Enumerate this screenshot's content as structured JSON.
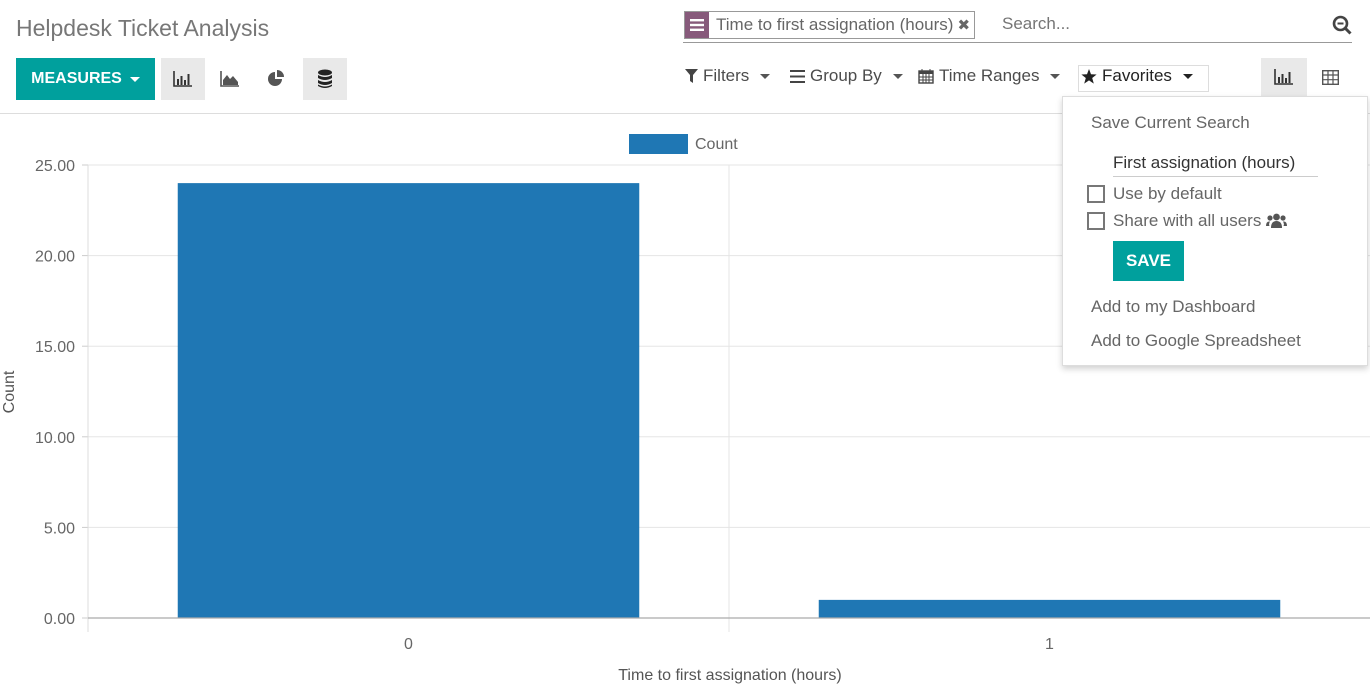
{
  "header": {
    "title": "Helpdesk Ticket Analysis",
    "measures_label": "MEASURES"
  },
  "chart_types": [
    {
      "name": "bar-chart",
      "active": true
    },
    {
      "name": "line-chart",
      "active": false
    },
    {
      "name": "pie-chart",
      "active": false
    },
    {
      "name": "stacked",
      "active": true
    }
  ],
  "search": {
    "facet_value": "Time to first assignation (hours)",
    "facet_remove": "✖",
    "placeholder": "Search..."
  },
  "toolbar": {
    "filters": "Filters",
    "group_by": "Group By",
    "time_ranges": "Time Ranges",
    "favorites": "Favorites"
  },
  "view_switcher": [
    {
      "name": "graph-view",
      "active": true
    },
    {
      "name": "pivot-view",
      "active": false
    }
  ],
  "favorites_menu": {
    "save_current_search": "Save Current Search",
    "search_name_value": "First assignation (hours)",
    "use_by_default": "Use by default",
    "use_by_default_checked": false,
    "share_with_all_users": "Share with all users",
    "share_checked": false,
    "save_label": "SAVE",
    "add_to_dashboard": "Add to my Dashboard",
    "add_to_google_spreadsheet": "Add to Google Spreadsheet"
  },
  "colors": {
    "accent": "#00a09d",
    "facet": "#875a7b",
    "bar": "#1f77b4"
  },
  "chart_data": {
    "type": "bar",
    "title": "",
    "categories": [
      "0",
      "1"
    ],
    "series": [
      {
        "name": "Count",
        "values": [
          24,
          1
        ]
      }
    ],
    "xlabel": "Time to first assignation (hours)",
    "ylabel": "Count",
    "ylim": [
      0,
      25
    ],
    "yticks": [
      "0.00",
      "5.00",
      "10.00",
      "15.00",
      "20.00",
      "25.00"
    ],
    "ytick_values": [
      0,
      5,
      10,
      15,
      20,
      25
    ],
    "grid": true,
    "legend": "top-center"
  }
}
